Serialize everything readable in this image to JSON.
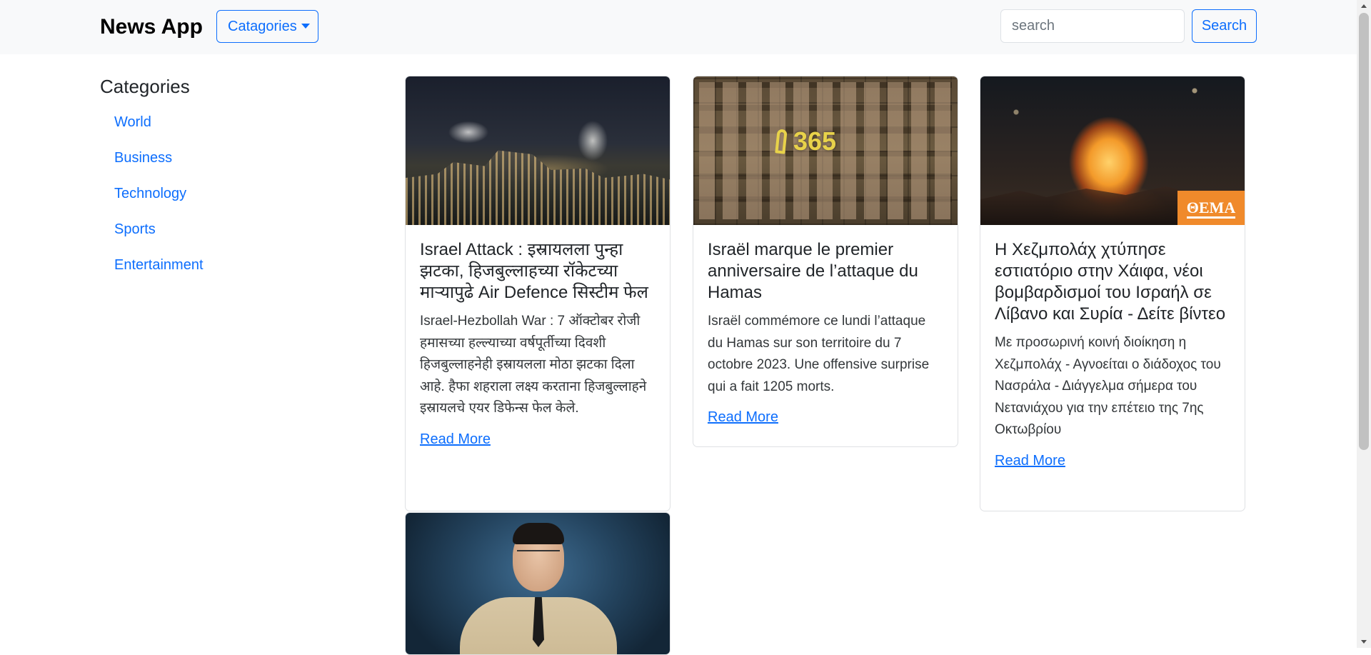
{
  "navbar": {
    "brand": "News App",
    "dropdown_label": "Catagories",
    "search_placeholder": "search",
    "search_button": "Search"
  },
  "sidebar": {
    "title": "Categories",
    "items": [
      {
        "label": "World"
      },
      {
        "label": "Business"
      },
      {
        "label": "Technology"
      },
      {
        "label": "Sports"
      },
      {
        "label": "Entertainment"
      }
    ]
  },
  "articles": [
    {
      "image": "night-city-smoke-image",
      "title": "Israel Attack : इस्रायलला पुन्हा झटका, हिजबुल्लाहच्या रॉकेटच्या माऱ्यापुढे Air Defence सिस्टीम फेल",
      "description": "Israel-Hezbollah War : 7 ऑक्टोबर रोजी हमासच्या हल्ल्याच्या वर्षपूर्तीच्या दिवशी हिजबुल्लाहनेही इस्रायलला मोठा झटका दिला आहे. हैफा शहराला लक्ष्य करताना हिजबुल्लाहने इस्रायलचे एयर डिफेन्स फेल केले.",
      "link": "Read More"
    },
    {
      "image": "wall-of-hostage-photos-image",
      "image_text": "365",
      "title": "Israël marque le premier anniversaire de l’attaque du Hamas",
      "description": "Israël commémore ce lundi l’attaque du Hamas sur son territoire du 7 octobre 2023. Une offensive surprise qui a fait 1205 morts.",
      "link": "Read More"
    },
    {
      "image": "explosion-night-image",
      "image_logo": "ΘΕΜΑ",
      "title": "Η Χεζμπολάχ χτύπησε εστιατόριο στην Χάιφα, νέοι βομβαρδισμοί του Ισραήλ σε Λίβανο και Συρία - Δείτε βίντεο",
      "description": "Με προσωρινή κοινή διοίκηση η Χεζμπολάχ - Αγνοείται ο διάδοχος του Νασράλα - Διάγγελμα σήμερα του Νετανιάχου για την επέτειο της 7ης Οκτωβρίου",
      "link": "Read More"
    },
    {
      "image": "uniformed-officer-portrait-image"
    }
  ],
  "colors": {
    "accent": "#0d6efd",
    "navbar_bg": "#f8f9fa",
    "card_border": "#dfe1e4"
  }
}
